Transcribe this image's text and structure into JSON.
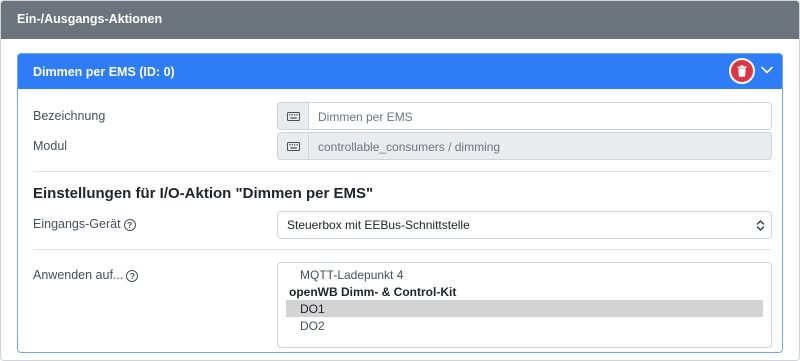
{
  "outer_card": {
    "title": "Ein-/Ausgangs-Aktionen"
  },
  "inner_card": {
    "title": "Dimmen per EMS (ID: 0)",
    "delete_icon": "trash-icon",
    "collapse_icon": "chevron-down-icon"
  },
  "fields": {
    "bezeichnung": {
      "label": "Bezeichnung",
      "value": "Dimmen per EMS",
      "icon": "keyboard-icon"
    },
    "modul": {
      "label": "Modul",
      "value": "controllable_consumers / dimming",
      "icon": "keyboard-icon"
    }
  },
  "settings": {
    "title": "Einstellungen für I/O-Aktion \"Dimmen per EMS\"",
    "input_device": {
      "label": "Eingangs-Gerät",
      "selected": "Steuerbox mit EEBus-Schnittstelle",
      "help_icon": "question-circle-icon"
    },
    "apply_to": {
      "label": "Anwenden auf...",
      "help_icon": "question-circle-icon",
      "options": [
        {
          "text": "MQTT-Ladepunkt 4",
          "type": "option",
          "selected": false
        },
        {
          "text": "openWB Dimm- & Control-Kit",
          "type": "group",
          "selected": false
        },
        {
          "text": "DO1",
          "type": "option",
          "selected": true
        },
        {
          "text": "DO2",
          "type": "option",
          "selected": false
        }
      ]
    }
  },
  "colors": {
    "outer_header": "#6c757d",
    "inner_header": "#2e7cf6",
    "delete_button": "#dc3545"
  }
}
